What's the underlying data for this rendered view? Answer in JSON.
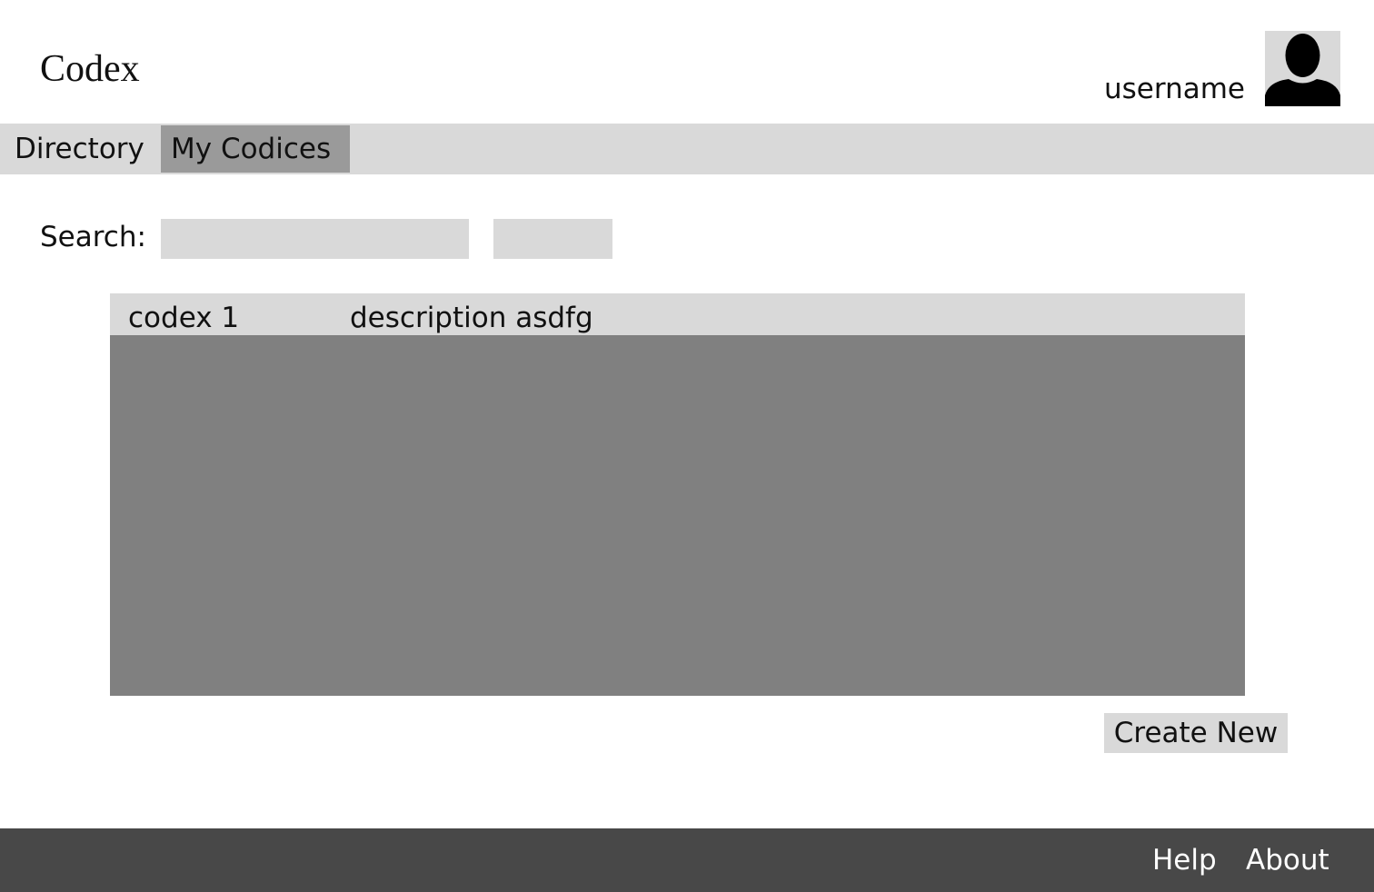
{
  "header": {
    "app_title": "Codex",
    "username": "username",
    "avatar_icon": "user-silhouette-icon"
  },
  "nav": {
    "tabs": [
      {
        "label": "Directory",
        "active": false
      },
      {
        "label": "My Codices",
        "active": true
      }
    ]
  },
  "search": {
    "label": "Search:",
    "value": "",
    "placeholder": "",
    "button_label": ""
  },
  "codices": [
    {
      "name": "codex 1",
      "description": "description asdfg"
    }
  ],
  "actions": {
    "create_label": "Create New"
  },
  "footer": {
    "links": [
      {
        "label": "Help"
      },
      {
        "label": "About"
      }
    ]
  },
  "colors": {
    "panel_light": "#d9d9d9",
    "tab_active": "#9a9a9a",
    "list_background": "#808080",
    "footer_background": "#484848",
    "avatar_figure": "#000000"
  }
}
